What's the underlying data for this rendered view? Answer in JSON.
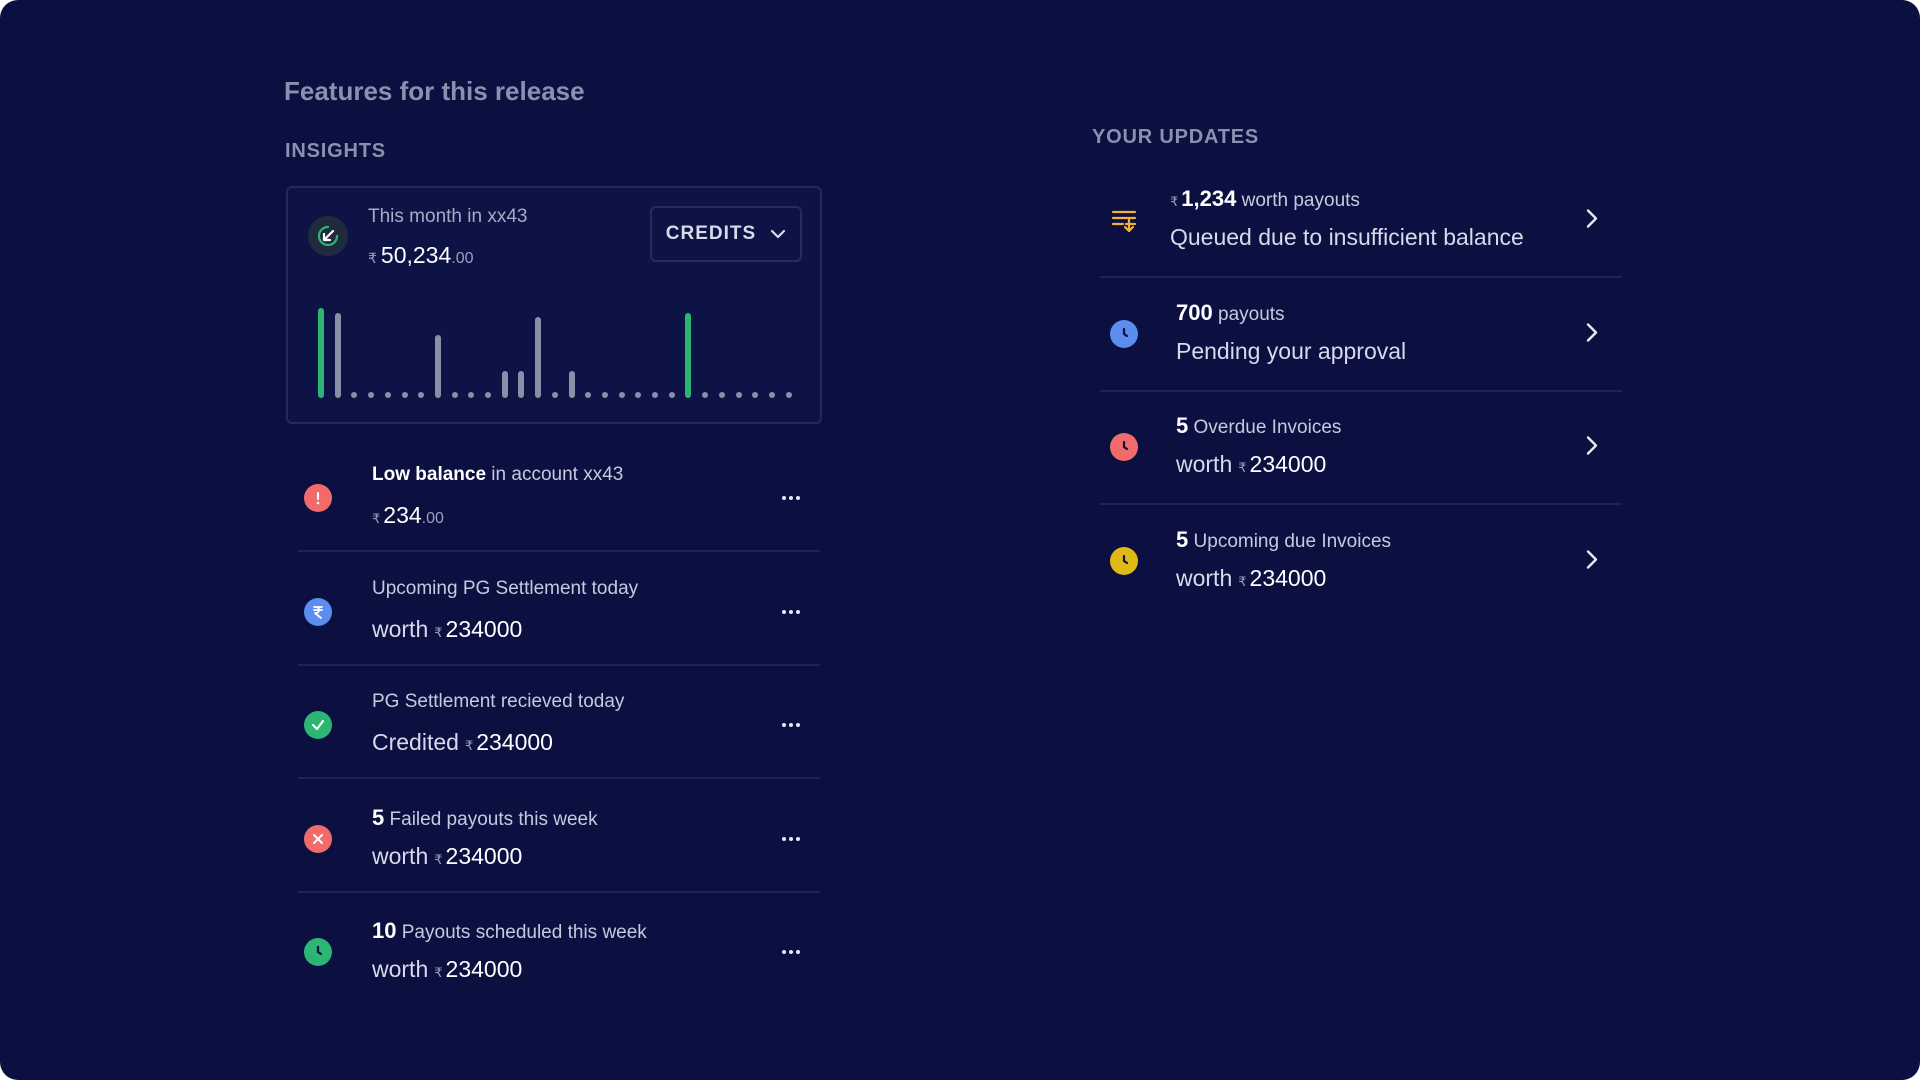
{
  "page": {
    "heading": "Features for this release"
  },
  "insights": {
    "label": "INSIGHTS",
    "card": {
      "subtitle": "This month in xx43",
      "currency": "₹",
      "amount": "50,234",
      "decimals": ".00",
      "dropdown_label": "CREDITS",
      "bars": [
        {
          "level": 1.0,
          "color": "#2bb673"
        },
        {
          "level": 0.94,
          "color": "#8a8fa8"
        },
        {
          "level": 0,
          "color": "#8a8fa8"
        },
        {
          "level": 0,
          "color": "#8a8fa8"
        },
        {
          "level": 0,
          "color": "#8a8fa8"
        },
        {
          "level": 0,
          "color": "#8a8fa8"
        },
        {
          "level": 0,
          "color": "#8a8fa8"
        },
        {
          "level": 0.7,
          "color": "#8a8fa8"
        },
        {
          "level": 0,
          "color": "#8a8fa8"
        },
        {
          "level": 0,
          "color": "#8a8fa8"
        },
        {
          "level": 0,
          "color": "#8a8fa8"
        },
        {
          "level": 0.3,
          "color": "#8a8fa8"
        },
        {
          "level": 0.3,
          "color": "#8a8fa8"
        },
        {
          "level": 0.9,
          "color": "#8a8fa8"
        },
        {
          "level": 0,
          "color": "#8a8fa8"
        },
        {
          "level": 0.3,
          "color": "#8a8fa8"
        },
        {
          "level": 0,
          "color": "#8a8fa8"
        },
        {
          "level": 0,
          "color": "#8a8fa8"
        },
        {
          "level": 0,
          "color": "#8a8fa8"
        },
        {
          "level": 0,
          "color": "#8a8fa8"
        },
        {
          "level": 0,
          "color": "#8a8fa8"
        },
        {
          "level": 0,
          "color": "#8a8fa8"
        },
        {
          "level": 0.94,
          "color": "#2bb673"
        },
        {
          "level": 0,
          "color": "#8a8fa8"
        },
        {
          "level": 0,
          "color": "#8a8fa8"
        },
        {
          "level": 0,
          "color": "#8a8fa8"
        },
        {
          "level": 0,
          "color": "#8a8fa8"
        },
        {
          "level": 0,
          "color": "#8a8fa8"
        },
        {
          "level": 0,
          "color": "#8a8fa8"
        }
      ]
    },
    "items": [
      {
        "icon": "alert-icon",
        "color": "#f26b6b",
        "lead": "Low balance",
        "text": " in account xx43",
        "currency": "₹",
        "value": "234",
        "decimals": ".00"
      },
      {
        "icon": "rupee-icon",
        "color": "#5b8def",
        "text": "Upcoming PG Settlement today",
        "prefix": "worth",
        "currency": "₹",
        "value": "234000"
      },
      {
        "icon": "check-icon",
        "color": "#2bb673",
        "text": "PG Settlement recieved today",
        "prefix": "Credited",
        "currency": "₹",
        "value": "234000"
      },
      {
        "icon": "cross-icon",
        "color": "#f26b6b",
        "count": "5",
        "text": " Failed payouts this week",
        "prefix": "worth",
        "currency": "₹",
        "value": "234000"
      },
      {
        "icon": "clock-icon",
        "color": "#2bb673",
        "count": "10",
        "text": " Payouts scheduled this week",
        "prefix": "worth",
        "currency": "₹",
        "value": "234000"
      }
    ]
  },
  "updates": {
    "label": "YOUR UPDATES",
    "items": [
      {
        "icon": "queue-icon",
        "color": "#f2b233",
        "currency": "₹",
        "count": "1,234",
        "text": " worth payouts",
        "line2": "Queued due to insufficient balance"
      },
      {
        "icon": "clock-icon",
        "color": "#5b8def",
        "count": "700",
        "text": " payouts",
        "line2": "Pending your approval"
      },
      {
        "icon": "clock-icon",
        "color": "#f26b6b",
        "count": "5",
        "text": " Overdue Invoices",
        "prefix": "worth",
        "currency": "₹",
        "value": "234000"
      },
      {
        "icon": "clock-icon",
        "color": "#e0b915",
        "count": "5",
        "text": " Upcoming due Invoices",
        "prefix": "worth",
        "currency": "₹",
        "value": "234000"
      }
    ]
  }
}
